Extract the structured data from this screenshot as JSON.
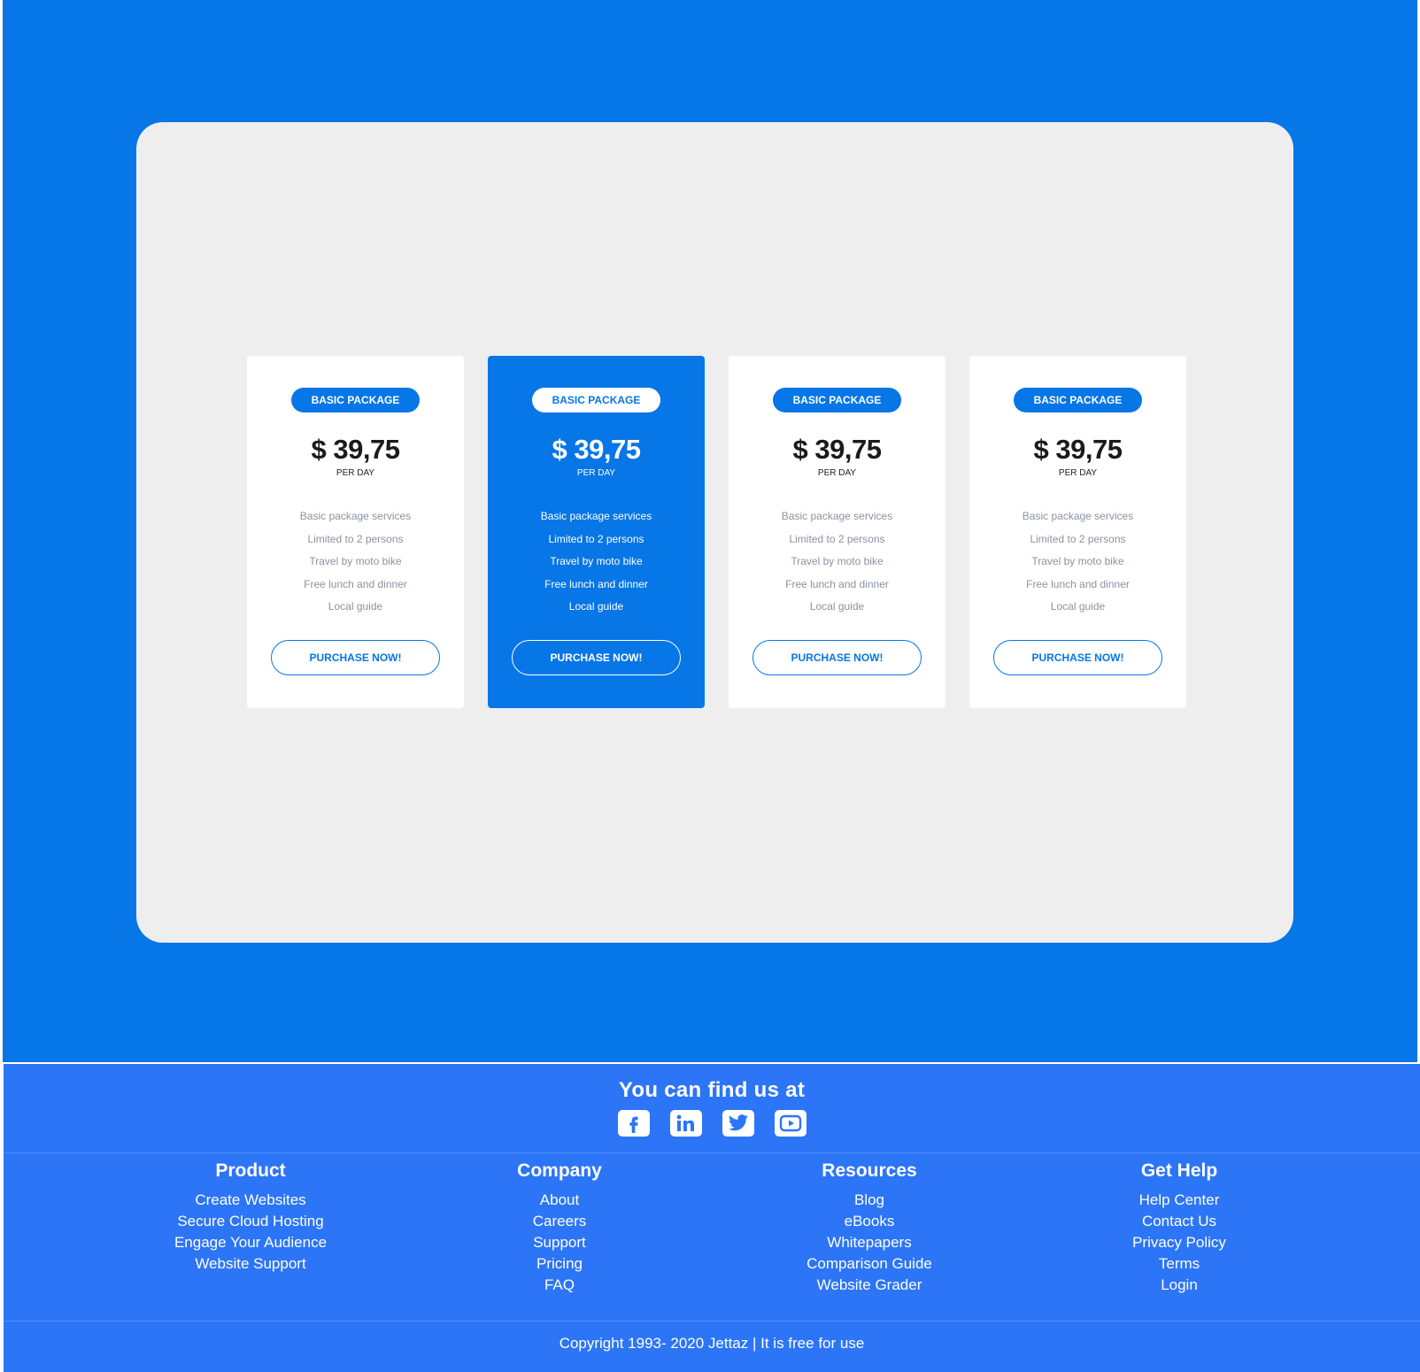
{
  "pricing": {
    "cards": [
      {
        "badge": "BASIC PACKAGE",
        "price": "$ 39,75",
        "per": "PER DAY",
        "features": [
          "Basic package services",
          "Limited to 2 persons",
          "Travel by moto bike",
          "Free lunch and dinner",
          "Local guide"
        ],
        "button": "PURCHASE NOW!"
      },
      {
        "badge": "BASIC PACKAGE",
        "price": "$ 39,75",
        "per": "PER DAY",
        "features": [
          "Basic package services",
          "Limited to 2 persons",
          "Travel by moto bike",
          "Free lunch and dinner",
          "Local guide"
        ],
        "button": "PURCHASE NOW!"
      },
      {
        "badge": "BASIC PACKAGE",
        "price": "$ 39,75",
        "per": "PER DAY",
        "features": [
          "Basic package services",
          "Limited to 2 persons",
          "Travel by moto bike",
          "Free lunch and dinner",
          "Local guide"
        ],
        "button": "PURCHASE NOW!"
      },
      {
        "badge": "BASIC PACKAGE",
        "price": "$ 39,75",
        "per": "PER DAY",
        "features": [
          "Basic package services",
          "Limited to 2 persons",
          "Travel by moto bike",
          "Free lunch and dinner",
          "Local guide"
        ],
        "button": "PURCHASE NOW!"
      }
    ]
  },
  "footer": {
    "find_title": "You can find us at",
    "socials": [
      {
        "icon": "facebook-icon"
      },
      {
        "icon": "linkedin-icon"
      },
      {
        "icon": "twitter-icon"
      },
      {
        "icon": "youtube-icon"
      }
    ],
    "columns": [
      {
        "title": "Product",
        "links": [
          "Create Websites",
          "Secure Cloud Hosting",
          "Engage Your Audience",
          "Website Support"
        ]
      },
      {
        "title": "Company",
        "links": [
          "About",
          "Careers",
          "Support",
          "Pricing",
          "FAQ"
        ]
      },
      {
        "title": "Resources",
        "links": [
          "Blog",
          "eBooks",
          "Whitepapers",
          "Comparison Guide",
          "Website Grader"
        ]
      },
      {
        "title": "Get Help",
        "links": [
          "Help Center",
          "Contact Us",
          "Privacy Policy",
          "Terms",
          "Login"
        ]
      }
    ],
    "copyright": "Copyright 1993- 2020 Jettaz | It is free for use"
  },
  "colors": {
    "primary_blue": "#0776e6",
    "footer_blue": "#2c75f7",
    "panel_gray": "#eeeeee",
    "feature_text": "#8a93a0"
  }
}
